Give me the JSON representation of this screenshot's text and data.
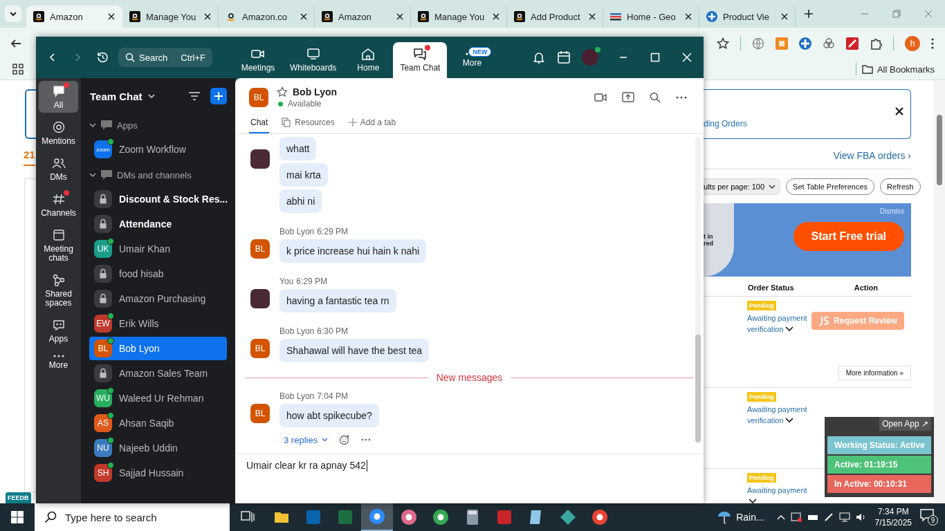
{
  "browser": {
    "tabs": [
      {
        "kind": "amazon",
        "label": "Amazon",
        "selected": true
      },
      {
        "kind": "amazon",
        "label": "Manage You",
        "selected": false
      },
      {
        "kind": "amazon-smile",
        "label": "Amazon.co",
        "selected": false
      },
      {
        "kind": "amazon",
        "label": "Amazon",
        "selected": false
      },
      {
        "kind": "amazon",
        "label": "Manage You",
        "selected": false
      },
      {
        "kind": "amazon",
        "label": "Add Product",
        "selected": false
      },
      {
        "kind": "geo",
        "label": "Home - Geo",
        "selected": false
      },
      {
        "kind": "product",
        "label": "Product Vie",
        "selected": false
      }
    ],
    "profile_initial": "h",
    "bookmarks_label": "All Bookmarks"
  },
  "page": {
    "count": "21",
    "feedback_tab": "FEEDB",
    "banner_link": "ding Orders",
    "fba_link": "View FBA orders ›",
    "results_select": "ults per page: 100",
    "buttons": [
      "Set Table Preferences",
      "Refresh"
    ],
    "promo": {
      "dismiss": "Dismiss",
      "cta": "Start Free trial",
      "text_lines": [
        "t in",
        "red"
      ]
    },
    "columns": [
      "Order Status",
      "Action"
    ],
    "orders": [
      {
        "badge": "Pending",
        "status": "Awaiting payment verification",
        "action": "Request Review",
        "more_info": "More information »"
      },
      {
        "badge": "Pending",
        "status": "Awaiting payment verification"
      },
      {
        "badge": "Pending",
        "status": "Awaiting payment"
      }
    ]
  },
  "zoom": {
    "search": {
      "placeholder": "Search",
      "shortcut": "Ctrl+F"
    },
    "nav": [
      {
        "kind": "meetings",
        "label": "Meetings",
        "selected": false,
        "unread": false
      },
      {
        "kind": "whiteboards",
        "label": "Whiteboards",
        "selected": false,
        "unread": false
      },
      {
        "kind": "home",
        "label": "Home",
        "selected": false,
        "unread": false
      },
      {
        "kind": "chat",
        "label": "Team Chat",
        "selected": true,
        "unread": true
      },
      {
        "kind": "more",
        "label": "More",
        "selected": false,
        "unread": false,
        "badge": "NEW"
      }
    ],
    "rail": [
      {
        "kind": "all",
        "label": "All",
        "selected": true,
        "unread": true
      },
      {
        "kind": "mentions",
        "label": "Mentions",
        "selected": false,
        "unread": false
      },
      {
        "kind": "dms",
        "label": "DMs",
        "selected": false,
        "unread": false
      },
      {
        "kind": "channels",
        "label": "Channels",
        "selected": false,
        "unread": true
      },
      {
        "kind": "meeting-chats",
        "label": "Meeting chats",
        "selected": false,
        "unread": false
      },
      {
        "kind": "shared",
        "label": "Shared spaces",
        "selected": false,
        "unread": false
      },
      {
        "kind": "apps",
        "label": "Apps",
        "selected": false,
        "unread": false
      },
      {
        "kind": "more",
        "label": "More",
        "selected": false,
        "unread": false
      }
    ],
    "list": {
      "title": "Team Chat",
      "sections": [
        {
          "label": "Apps",
          "expanded": true,
          "items": [
            {
              "kind": "app",
              "label": "Zoom Workflow",
              "logo_text": "zoom",
              "online": true,
              "selected": false,
              "unread": false
            }
          ]
        },
        {
          "label": "DMs and channels",
          "expanded": true,
          "items": [
            {
              "kind": "channel",
              "label": "Discount & Stock Res...",
              "selected": false,
              "unread": true
            },
            {
              "kind": "channel",
              "label": "Attendance",
              "selected": false,
              "unread": true
            },
            {
              "kind": "person",
              "label": "Umair Khan",
              "initials": "UK",
              "color": "#1a9e8a",
              "online": true,
              "selected": false,
              "unread": false
            },
            {
              "kind": "channel",
              "label": "food hisab",
              "selected": false,
              "unread": false
            },
            {
              "kind": "channel",
              "label": "Amazon Purchasing",
              "selected": false,
              "unread": false
            },
            {
              "kind": "person",
              "label": "Erik Wills",
              "initials": "EW",
              "color": "#c0392b",
              "online": true,
              "selected": false,
              "unread": false
            },
            {
              "kind": "person",
              "label": "Bob Lyon",
              "initials": "BL",
              "color": "#d35400",
              "online": true,
              "selected": true,
              "unread": false
            },
            {
              "kind": "channel",
              "label": "Amazon Sales Team",
              "selected": false,
              "unread": false
            },
            {
              "kind": "person",
              "label": "Waleed Ur Rehman",
              "initials": "WU",
              "color": "#27ae60",
              "online": true,
              "selected": false,
              "unread": false
            },
            {
              "kind": "person",
              "label": "Ahsan Saqib",
              "initials": "AS",
              "color": "#e05a1a",
              "online": true,
              "selected": false,
              "unread": false
            },
            {
              "kind": "person",
              "label": "Najeeb Uddin",
              "initials": "NU",
              "color": "#3a7bbf",
              "online": true,
              "selected": false,
              "unread": false
            },
            {
              "kind": "person",
              "label": "Sajjad Hussain",
              "initials": "SH",
              "color": "#c0392b",
              "online": true,
              "selected": false,
              "unread": false
            }
          ]
        }
      ]
    },
    "chat": {
      "contact": {
        "initials": "BL",
        "name": "Bob Lyon",
        "status": "Available",
        "starred": false
      },
      "tabs": [
        {
          "kind": "chat",
          "label": "Chat",
          "selected": true
        },
        {
          "kind": "resources",
          "label": "Resources",
          "selected": false
        },
        {
          "kind": "add",
          "label": "Add a tab",
          "selected": false
        }
      ],
      "messages": [
        {
          "kind": "message",
          "bubbles": [
            "whatt",
            "mai krta",
            "abhi ni"
          ]
        },
        {
          "kind": "message",
          "sender": "Bob Lyon",
          "time": "6:29 PM",
          "initials": "BL",
          "bubbles": [
            "k price increase hui hain k nahi"
          ]
        },
        {
          "kind": "message",
          "sender": "You",
          "time": "6:29 PM",
          "bubbles": [
            "having a fantastic tea rn"
          ]
        },
        {
          "kind": "message",
          "sender": "Bob Lyon",
          "time": "6:30 PM",
          "initials": "BL",
          "bubbles": [
            "Shahawal will have the best tea"
          ]
        },
        {
          "kind": "divider",
          "label": "New messages"
        },
        {
          "kind": "message",
          "sender": "Bob Lyon",
          "time": "7:04 PM",
          "initials": "BL",
          "bubbles": [
            "how abt spikecube?"
          ],
          "replies": "3 replies"
        }
      ],
      "composer_value": "Umair clear kr ra apnay 542"
    }
  },
  "status_widget": {
    "open_label": "Open App ↗",
    "rows": [
      {
        "label": "Working Status: Active",
        "color": "#7cc4cf"
      },
      {
        "label": "Active: 01:19:15",
        "color": "#4fc27a"
      },
      {
        "label": "In Active: 00:10:31",
        "color": "#e8675d"
      }
    ]
  },
  "taskbar": {
    "search_placeholder": "Type here to search",
    "apps": [
      {
        "kind": "folder",
        "active": false
      },
      {
        "kind": "mail",
        "active": false
      },
      {
        "kind": "sheet",
        "active": false
      },
      {
        "kind": "video",
        "active": true
      },
      {
        "kind": "pinwheel",
        "active": false
      },
      {
        "kind": "browser-m",
        "active": false
      },
      {
        "kind": "calculator",
        "active": false
      },
      {
        "kind": "ftp",
        "active": false
      },
      {
        "kind": "notepad",
        "active": false
      },
      {
        "kind": "diamond",
        "active": false
      },
      {
        "kind": "browser",
        "active": false
      }
    ],
    "weather": "Rain...",
    "time": "7:34 PM",
    "date": "7/15/2025",
    "notification_count": "9"
  }
}
